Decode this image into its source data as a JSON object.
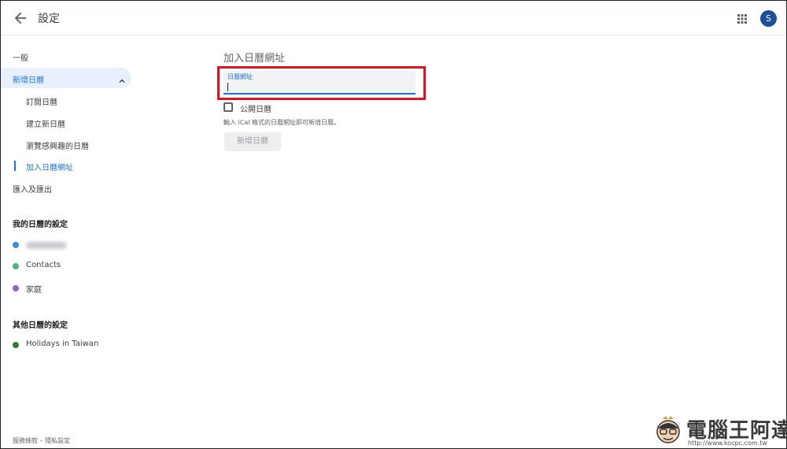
{
  "header": {
    "title": "設定",
    "avatar_initial": "S"
  },
  "sidebar": {
    "general": "一般",
    "add_calendar": "新增日曆",
    "sub_items": [
      "訂閱日曆",
      "建立新日曆",
      "瀏覽感興趣的日曆",
      "加入日曆網址"
    ],
    "import_export": "匯入及匯出",
    "my_calendars_title": "我的日曆的設定",
    "my_calendars": [
      {
        "label": "",
        "color": "#3a8fd6"
      },
      {
        "label": "Contacts",
        "color": "#4cb877"
      },
      {
        "label": "家庭",
        "color": "#8e63ce"
      }
    ],
    "other_calendars_title": "其他日曆的設定",
    "other_calendars": [
      {
        "label": "Holidays in Taiwan",
        "color": "#2e7d32"
      }
    ],
    "footer": {
      "terms": "服務條款",
      "separator": " – ",
      "privacy": "隱私設定"
    }
  },
  "main": {
    "title": "加入日曆網址",
    "url_field_label": "日曆網址",
    "url_value": "",
    "public_checkbox_label": "公開日曆",
    "public_checked": false,
    "hint": "輸入 iCal 格式的日曆網址即可新增日曆。",
    "add_button": "新增日曆"
  },
  "watermark": {
    "text": "電腦王阿達",
    "url": "http://www.kocpc.com.tw"
  }
}
